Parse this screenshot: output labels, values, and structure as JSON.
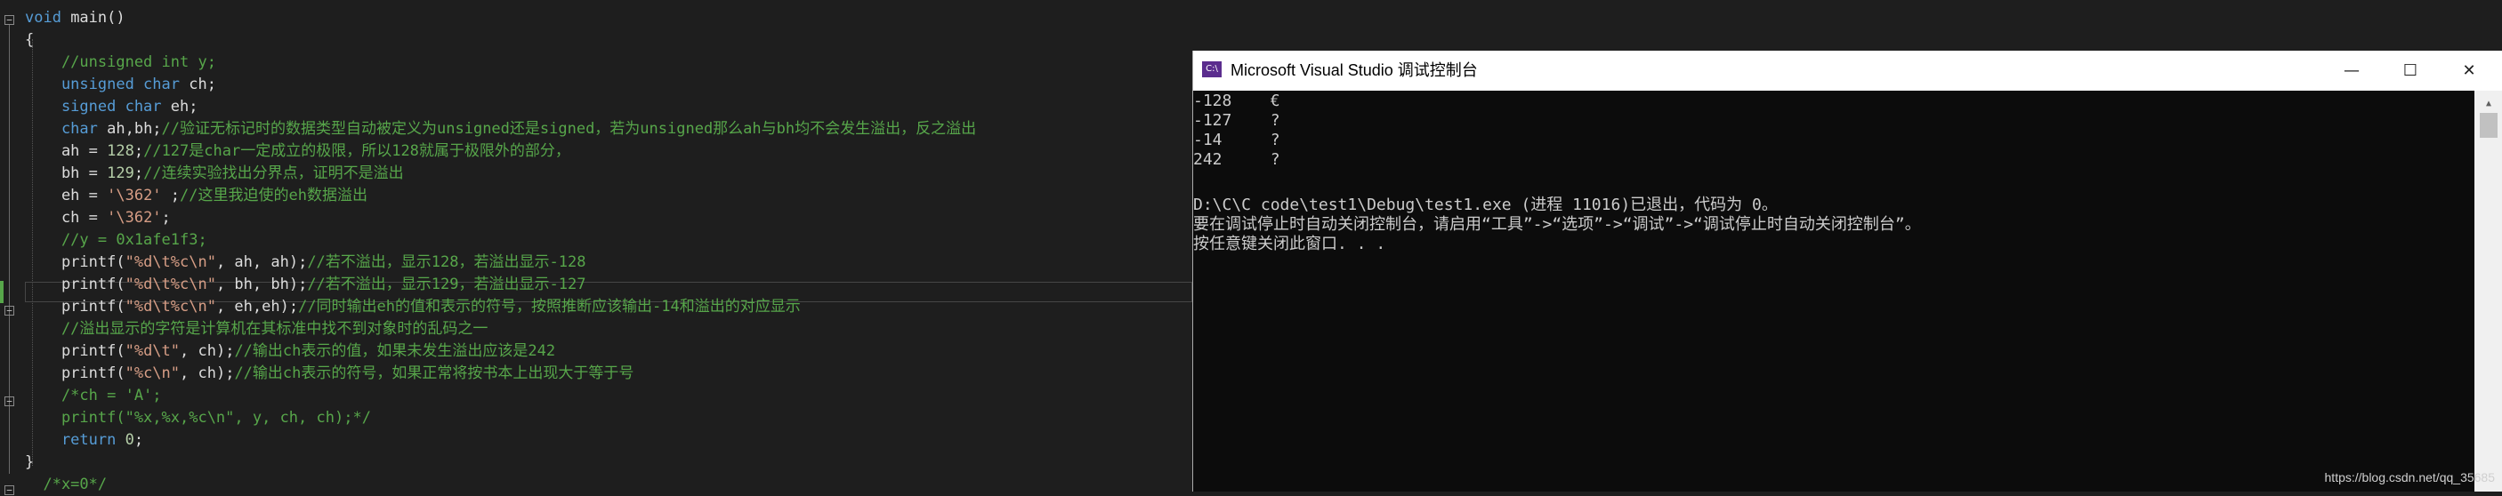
{
  "editor": {
    "lines": [
      {
        "parts": [
          {
            "c": "kw",
            "t": "void"
          },
          {
            "c": "",
            "t": " main()"
          }
        ]
      },
      {
        "parts": [
          {
            "c": "",
            "t": "{"
          }
        ]
      },
      {
        "parts": [
          {
            "c": "cm",
            "t": "    //unsigned int y;"
          }
        ]
      },
      {
        "parts": [
          {
            "c": "kw",
            "t": "    unsigned char"
          },
          {
            "c": "",
            "t": " ch;"
          }
        ]
      },
      {
        "parts": [
          {
            "c": "kw",
            "t": "    signed char"
          },
          {
            "c": "",
            "t": " eh;"
          }
        ]
      },
      {
        "parts": [
          {
            "c": "kw",
            "t": "    char"
          },
          {
            "c": "",
            "t": " ah,bh;"
          },
          {
            "c": "cm",
            "t": "//验证无标记时的数据类型自动被定义为unsigned还是signed，若为unsigned那么ah与bh均不会发生溢出，反之溢出"
          }
        ]
      },
      {
        "parts": [
          {
            "c": "",
            "t": "    ah = "
          },
          {
            "c": "nm",
            "t": "128"
          },
          {
            "c": "",
            "t": ";"
          },
          {
            "c": "cm",
            "t": "//127是char一定成立的极限，所以128就属于极限外的部分，"
          }
        ]
      },
      {
        "parts": [
          {
            "c": "",
            "t": "    bh = "
          },
          {
            "c": "nm",
            "t": "129"
          },
          {
            "c": "",
            "t": ";"
          },
          {
            "c": "cm",
            "t": "//连续实验找出分界点，证明不是溢出"
          }
        ]
      },
      {
        "parts": [
          {
            "c": "",
            "t": "    eh = "
          },
          {
            "c": "st",
            "t": "'\\362'"
          },
          {
            "c": "",
            "t": " ;"
          },
          {
            "c": "cm",
            "t": "//这里我迫使的eh数据溢出"
          }
        ]
      },
      {
        "parts": [
          {
            "c": "",
            "t": "    ch = "
          },
          {
            "c": "st",
            "t": "'\\362'"
          },
          {
            "c": "",
            "t": ";"
          }
        ]
      },
      {
        "parts": [
          {
            "c": "cm",
            "t": "    //y = 0x1afe1f3;"
          }
        ]
      },
      {
        "parts": [
          {
            "c": "",
            "t": "    printf("
          },
          {
            "c": "st",
            "t": "\"%d\\t%c\\n\""
          },
          {
            "c": "",
            "t": ", ah, ah);"
          },
          {
            "c": "cm",
            "t": "//若不溢出，显示128，若溢出显示-128"
          }
        ]
      },
      {
        "parts": [
          {
            "c": "",
            "t": "    printf("
          },
          {
            "c": "st",
            "t": "\"%d\\t%c\\n\""
          },
          {
            "c": "",
            "t": ", bh, bh);"
          },
          {
            "c": "cm",
            "t": "//若不溢出，显示129，若溢出显示-127"
          }
        ]
      },
      {
        "parts": [
          {
            "c": "",
            "t": "    printf("
          },
          {
            "c": "st",
            "t": "\"%d\\t%c\\n\""
          },
          {
            "c": "",
            "t": ", eh,eh);"
          },
          {
            "c": "cm",
            "t": "//同时输出eh的值和表示的符号，按照推断应该输出-14和溢出的对应显示"
          }
        ]
      },
      {
        "parts": [
          {
            "c": "cm",
            "t": "    //溢出显示的字符是计算机在其标准中找不到对象时的乱码之一"
          }
        ]
      },
      {
        "parts": [
          {
            "c": "",
            "t": "    printf("
          },
          {
            "c": "st",
            "t": "\"%d\\t\""
          },
          {
            "c": "",
            "t": ", ch);"
          },
          {
            "c": "cm",
            "t": "//输出ch表示的值，如果未发生溢出应该是242"
          }
        ]
      },
      {
        "parts": [
          {
            "c": "",
            "t": "    printf("
          },
          {
            "c": "st",
            "t": "\"%c\\n\""
          },
          {
            "c": "",
            "t": ", ch);"
          },
          {
            "c": "cm",
            "t": "//输出ch表示的符号，如果正常将按书本上出现大于等于号"
          }
        ]
      },
      {
        "parts": [
          {
            "c": "cm",
            "t": "    /*ch = 'A';"
          }
        ]
      },
      {
        "parts": [
          {
            "c": "cm",
            "t": "    printf(\"%x,%x,%c\\n\", y, ch, ch);*/"
          }
        ]
      },
      {
        "parts": [
          {
            "c": "kw",
            "t": "    return"
          },
          {
            "c": "",
            "t": " "
          },
          {
            "c": "nm",
            "t": "0"
          },
          {
            "c": "",
            "t": ";"
          }
        ]
      },
      {
        "parts": [
          {
            "c": "",
            "t": "}"
          }
        ]
      },
      {
        "parts": [
          {
            "c": "cm",
            "t": "  /*x=0*/"
          }
        ]
      }
    ]
  },
  "console": {
    "icon_text": "C:\\",
    "title": "Microsoft Visual Studio 调试控制台",
    "minimize": "—",
    "maximize": "☐",
    "close": "✕",
    "output": [
      "-128    €",
      "-127    ?",
      "-14     ?",
      "242     ?",
      "",
      "D:\\C\\C code\\test1\\Debug\\test1.exe (进程 11016)已退出，代码为 0。",
      "要在调试停止时自动关闭控制台，请启用“工具”->“选项”->“调试”->“调试停止时自动关闭控制台”。",
      "按任意键关闭此窗口. . ."
    ]
  },
  "watermark": "https://blog.csdn.net/qq_35685"
}
